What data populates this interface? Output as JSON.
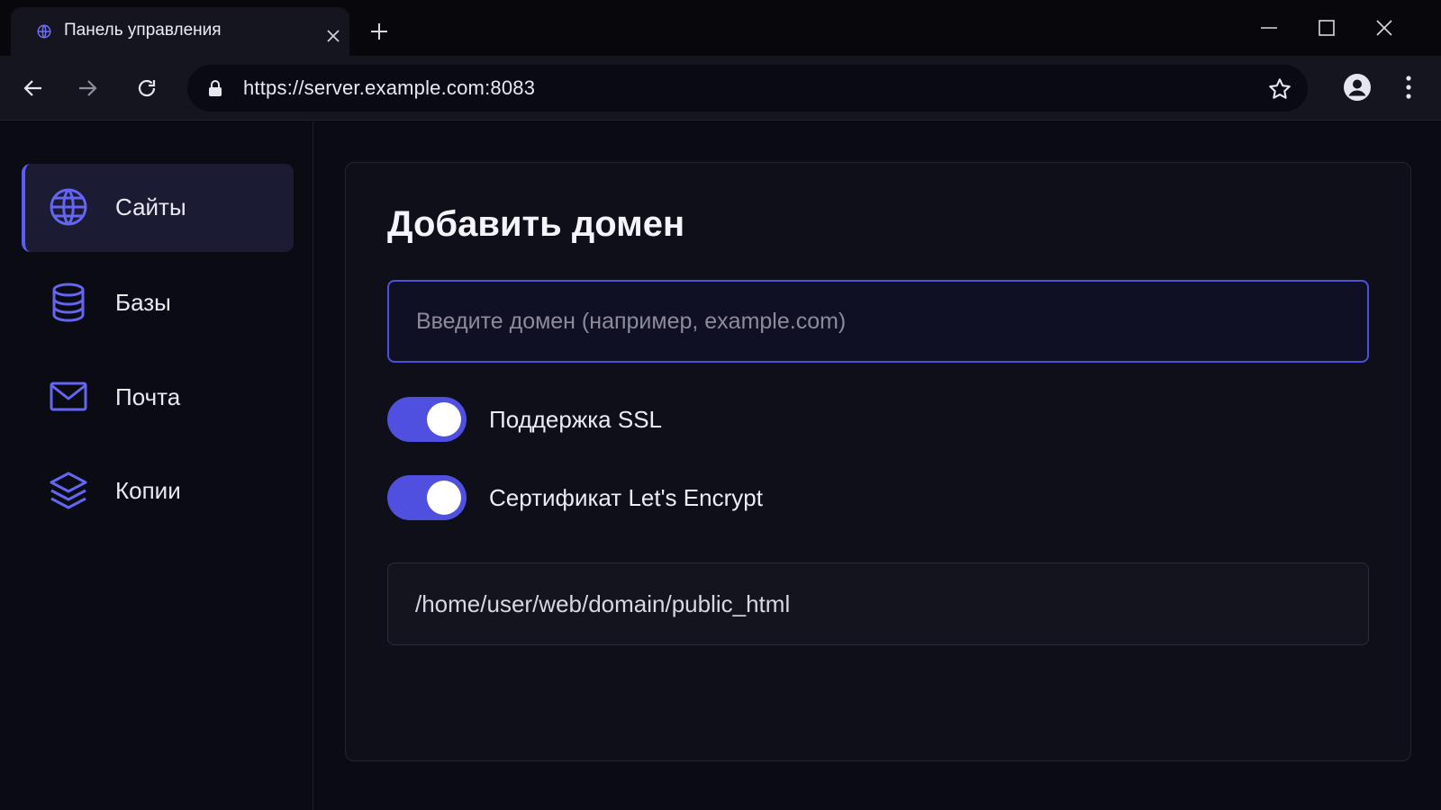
{
  "browser": {
    "tab_title": "Панель управления",
    "url": "https://server.example.com:8083"
  },
  "sidebar": {
    "items": [
      {
        "label": "Сайты",
        "icon": "globe-icon",
        "active": true
      },
      {
        "label": "Базы",
        "icon": "database-icon",
        "active": false
      },
      {
        "label": "Почта",
        "icon": "mail-icon",
        "active": false
      },
      {
        "label": "Копии",
        "icon": "layers-icon",
        "active": false
      }
    ]
  },
  "form": {
    "title": "Добавить домен",
    "domain_placeholder": "Введите домен (например, example.com)",
    "domain_value": "",
    "ssl_label": "Поддержка SSL",
    "ssl_enabled": true,
    "letsencrypt_label": "Сертификат Let's Encrypt",
    "letsencrypt_enabled": true,
    "path_value": "/home/user/web/domain/public_html"
  },
  "colors": {
    "accent": "#5b5ef0",
    "background": "#0b0b14",
    "card": "#0f0f1a"
  }
}
